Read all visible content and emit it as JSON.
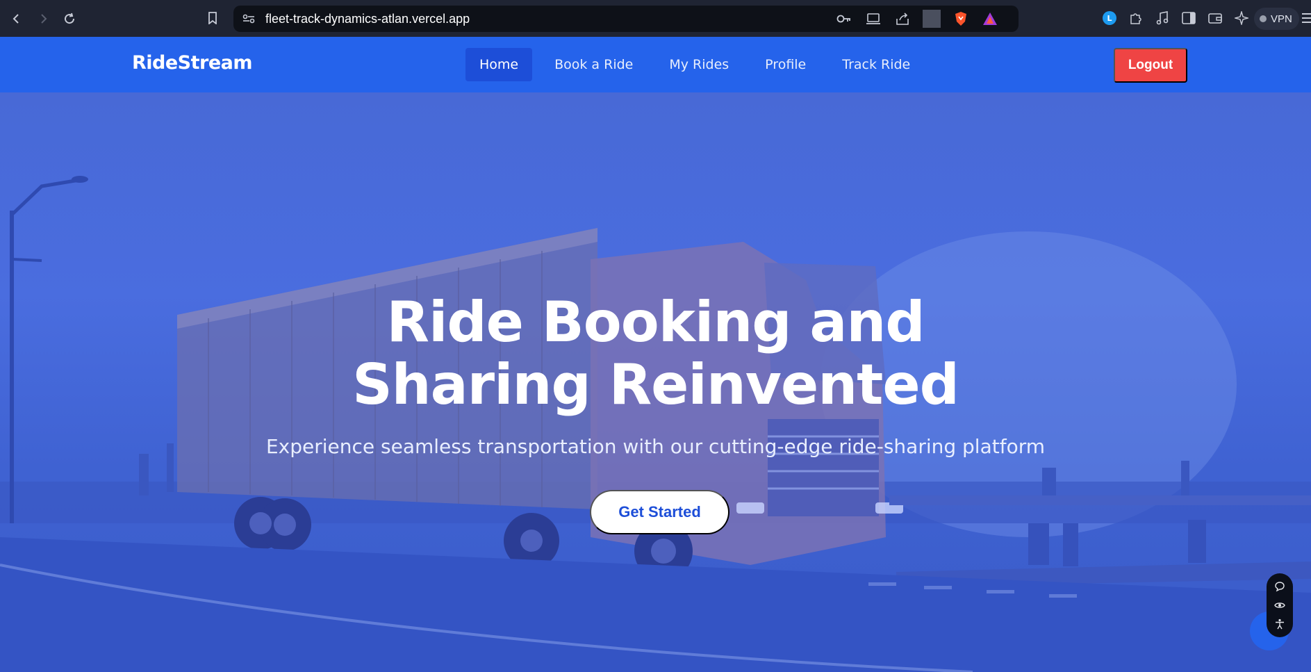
{
  "browser": {
    "url": "fleet-track-dynamics-atlan.vercel.app",
    "vpn_label": "VPN",
    "icons": [
      "back-icon",
      "forward-icon",
      "reload-icon",
      "bookmark-icon",
      "site-settings-icon",
      "key-icon",
      "cast-icon",
      "share-icon",
      "brave-shield-icon",
      "brave-rewards-icon",
      "extension-l-icon",
      "puzzle-icon",
      "music-icon",
      "sidebar-icon",
      "wallet-icon",
      "leo-ai-icon",
      "menu-icon"
    ]
  },
  "app": {
    "brand": "RideStream",
    "nav": [
      {
        "label": "Home",
        "active": true
      },
      {
        "label": "Book a Ride",
        "active": false
      },
      {
        "label": "My Rides",
        "active": false
      },
      {
        "label": "Profile",
        "active": false
      },
      {
        "label": "Track Ride",
        "active": false
      }
    ],
    "logout_label": "Logout"
  },
  "hero": {
    "title_line1": "Ride Booking and",
    "title_line2": "Sharing Reinvented",
    "subtitle": "Experience seamless transportation with our cutting-edge ride-sharing platform",
    "cta_label": "Get Started"
  },
  "widget": {
    "icons": [
      "chat-icon",
      "eye-icon",
      "accessibility-icon"
    ]
  },
  "colors": {
    "nav_bg": "#2563eb",
    "active_nav": "#1d4ed8",
    "logout": "#ef4444",
    "hero_overlay": "#3b5fd6"
  }
}
